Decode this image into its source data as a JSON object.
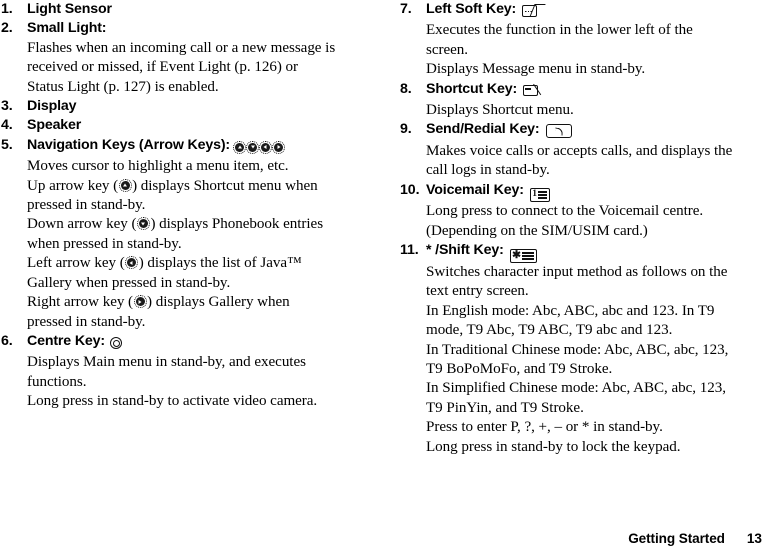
{
  "document": {
    "title": "Getting Started",
    "footer": {
      "section": "Getting Started",
      "page_number": "13"
    }
  },
  "columns": {
    "left": {
      "entries": [
        {
          "number": "1.",
          "heading": "Light Sensor",
          "icons": [],
          "body": []
        },
        {
          "number": "2.",
          "heading": "Small Light:",
          "icons": [],
          "body": [
            "Flashes when an incoming call or a new message is",
            "received or missed, if Event Light (p. 126) or",
            "Status Light (p. 127) is enabled."
          ]
        },
        {
          "number": "3.",
          "heading": "Display",
          "icons": [],
          "body": []
        },
        {
          "number": "4.",
          "heading": "Speaker",
          "icons": [],
          "body": []
        },
        {
          "number": "5.",
          "heading": "Navigation Keys (Arrow Keys):",
          "icons": [
            "nav-up-key-icon",
            "nav-down-key-icon",
            "nav-left-key-icon",
            "nav-right-key-icon"
          ],
          "body": [
            "Moves cursor to highlight a menu item, etc.",
            "Up arrow key (▲) displays Shortcut menu when",
            "pressed in stand-by.",
            "Down arrow key (▼) displays Phonebook entries",
            "when pressed in stand-by.",
            "Left arrow key (◀) displays the list of Java™",
            "Gallery when pressed in stand-by.",
            "Right arrow key (▶) displays Gallery when",
            "pressed in stand-by."
          ]
        },
        {
          "number": "6.",
          "heading": "Centre Key:",
          "icons": [
            "centre-key-icon"
          ],
          "body": [
            "Displays Main menu in stand-by, and executes",
            "functions.",
            "Long press in stand-by to activate video camera."
          ]
        }
      ]
    },
    "right": {
      "entries": [
        {
          "number": "7.",
          "heading": "Left Soft Key:",
          "icons": [
            "left-soft-key-icon"
          ],
          "body": [
            "Executes the function in the lower left of the",
            "screen.",
            "Displays Message menu in stand-by."
          ]
        },
        {
          "number": "8.",
          "heading": "Shortcut Key:",
          "icons": [
            "shortcut-key-icon"
          ],
          "body": [
            "Displays Shortcut menu."
          ]
        },
        {
          "number": "9.",
          "heading": "Send/Redial Key:",
          "icons": [
            "send-redial-key-icon"
          ],
          "body": [
            "Makes voice calls or accepts calls, and displays the",
            "call logs in stand-by."
          ]
        },
        {
          "number": "10.",
          "heading": "Voicemail Key:",
          "icons": [
            "voicemail-key-icon"
          ],
          "body": [
            "Long press to connect to the Voicemail centre.",
            "(Depending on the SIM/USIM card.)"
          ]
        },
        {
          "number": "11.",
          "heading": "* /Shift Key:",
          "icons": [
            "star-shift-key-icon"
          ],
          "body": [
            "Switches character input method as follows on the",
            "text entry screen.",
            "In English mode: Abc, ABC, abc and 123. In T9",
            "mode, T9 Abc, T9 ABC, T9 abc and 123.",
            "In Traditional Chinese mode: Abc, ABC, abc, 123,",
            "T9 BoPoMoFo, and T9 Stroke.",
            "In Simplified Chinese mode: Abc, ABC, abc, 123,",
            "T9 PinYin, and T9 Stroke.",
            "Press to enter P, ?, +, – or * in stand-by.",
            "Long press in stand-by to lock the keypad."
          ]
        }
      ]
    }
  },
  "icon_keys": {
    "voicemail": {
      "digit": "1"
    },
    "star": {
      "glyph": "✱"
    }
  },
  "colors": {
    "text": "#000000",
    "background": "#ffffff"
  }
}
